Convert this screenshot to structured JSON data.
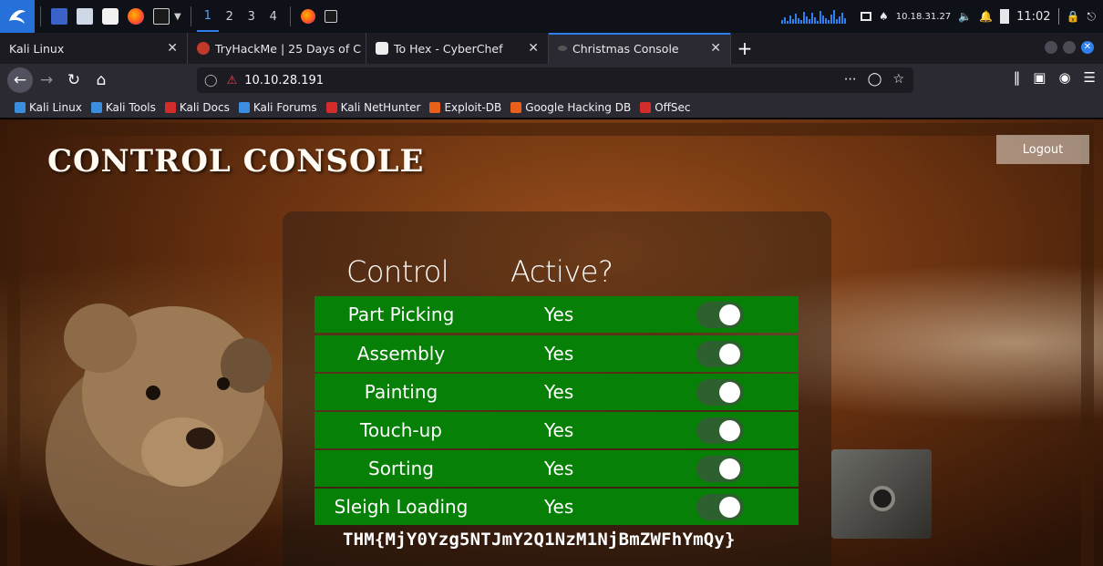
{
  "system_bar": {
    "workspaces": [
      "1",
      "2",
      "3",
      "4"
    ],
    "ip": "10.18.31.27",
    "clock": "11:02"
  },
  "tabs": [
    {
      "label": "Kali Linux",
      "active": false
    },
    {
      "label": "TryHackMe | 25 Days of C",
      "active": false
    },
    {
      "label": "To Hex - CyberChef",
      "active": false
    },
    {
      "label": "Christmas Console",
      "active": true
    }
  ],
  "nav": {
    "url": "10.10.28.191"
  },
  "bookmarks": [
    {
      "label": "Kali Linux",
      "color": "#3b8de0"
    },
    {
      "label": "Kali Tools",
      "color": "#3b8de0"
    },
    {
      "label": "Kali Docs",
      "color": "#d42b2b"
    },
    {
      "label": "Kali Forums",
      "color": "#3b8de0"
    },
    {
      "label": "Kali NetHunter",
      "color": "#d42b2b"
    },
    {
      "label": "Exploit-DB",
      "color": "#e8601a"
    },
    {
      "label": "Google Hacking DB",
      "color": "#e8601a"
    },
    {
      "label": "OffSec",
      "color": "#d42b2b"
    }
  ],
  "page": {
    "title": "CONTROL CONSOLE",
    "logout_label": "Logout",
    "col_control": "Control",
    "col_active": "Active?",
    "rows": [
      {
        "name": "Part Picking",
        "active": "Yes",
        "on": true
      },
      {
        "name": "Assembly",
        "active": "Yes",
        "on": true
      },
      {
        "name": "Painting",
        "active": "Yes",
        "on": true
      },
      {
        "name": "Touch-up",
        "active": "Yes",
        "on": true
      },
      {
        "name": "Sorting",
        "active": "Yes",
        "on": true
      },
      {
        "name": "Sleigh Loading",
        "active": "Yes",
        "on": true
      }
    ],
    "flag": "THM{MjY0Yzg5NTJmY2Q1NzM1NjBmZWFhYmQy}"
  },
  "colors": {
    "row_green": "#078007",
    "accent_blue": "#2f80ed"
  }
}
